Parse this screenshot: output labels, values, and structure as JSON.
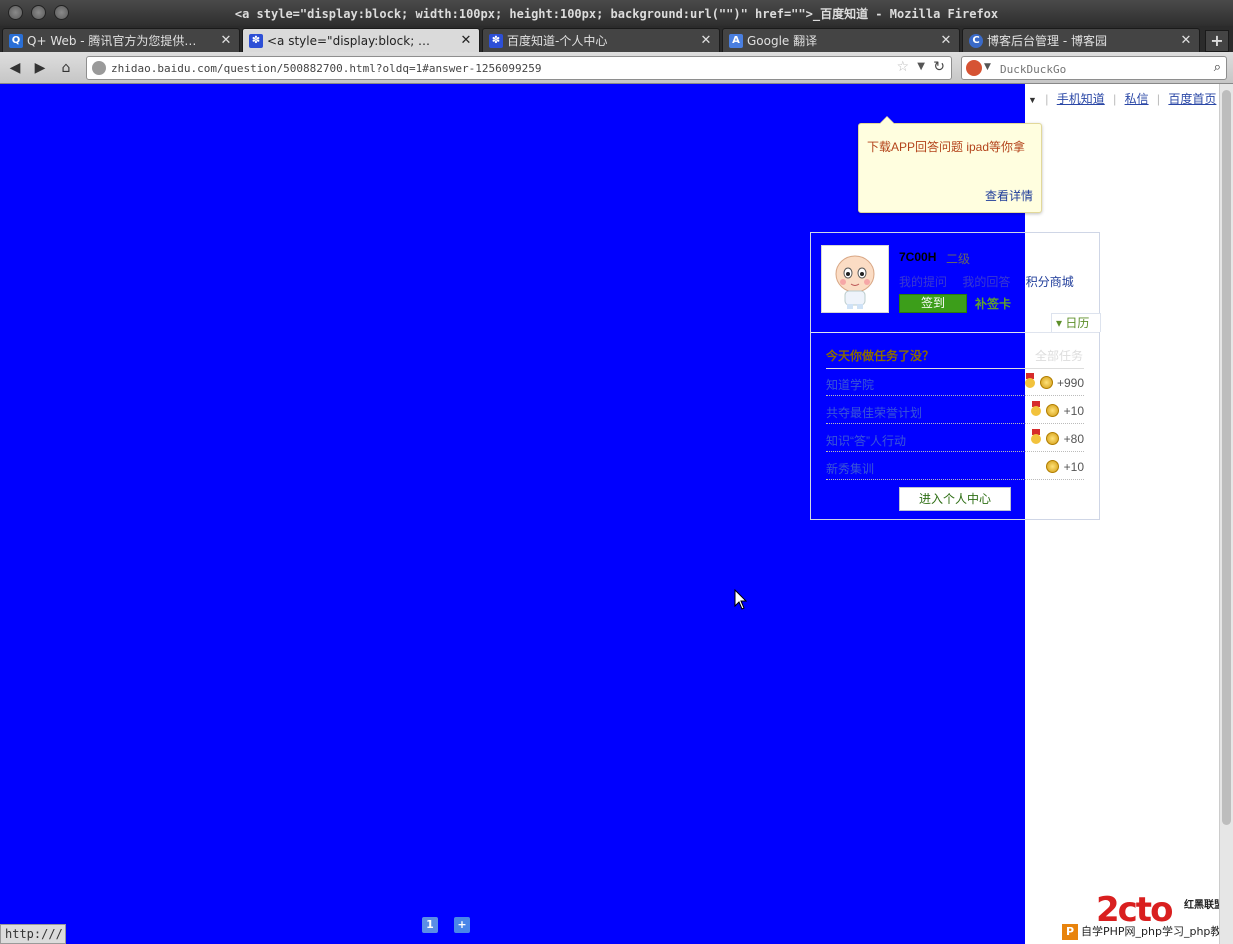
{
  "window": {
    "title": "<a style=\"display:block; width:100px; height:100px; background:url(\"\")\" href=\"\">_百度知道 - Mozilla Firefox"
  },
  "tabs": [
    {
      "label": "Q+ Web - 腾讯官方为您提供…",
      "favicon": "qplus-icon",
      "active": false
    },
    {
      "label": "<a style=\"display:block; …",
      "favicon": "baidu-paw-icon",
      "active": true
    },
    {
      "label": "百度知道-个人中心",
      "favicon": "baidu-paw-icon",
      "active": false
    },
    {
      "label": "Google 翻译",
      "favicon": "google-translate-icon",
      "active": false
    },
    {
      "label": "博客后台管理 - 博客园",
      "favicon": "cnblogs-icon",
      "active": false
    }
  ],
  "newtab_label": "+",
  "address": {
    "url": "zhidao.baidu.com/question/500882700.html?oldq=1#answer-1256099259"
  },
  "search": {
    "placeholder": "DuckDuckGo"
  },
  "toplinks": {
    "mobile": "手机知道",
    "messages": "私信",
    "home": "百度首页"
  },
  "tooltip": {
    "message": "下载APP回答问题 ipad等你拿",
    "details": "查看详情"
  },
  "user": {
    "name": "7C00H",
    "level": "二级",
    "links": [
      "我的提问",
      "我的回答",
      "积分商城"
    ],
    "sign_in": "签到",
    "makeup_card": "补签卡",
    "calendar": "日历"
  },
  "tasks": {
    "heading": "今天你做任务了没？",
    "all": "全部任务",
    "items": [
      {
        "name": "知道学院",
        "points": "+990",
        "medal": true
      },
      {
        "name": "共夺最佳荣誉计划",
        "points": "+10",
        "medal": true
      },
      {
        "name": "知识“答”人行动",
        "points": "+80",
        "medal": true
      },
      {
        "name": "新秀集训",
        "points": "+10",
        "medal": false
      }
    ],
    "enter": "进入个人中心"
  },
  "bottom_buttons": [
    "1",
    "+"
  ],
  "watermark": {
    "logo": "2cto",
    "caption": "红黑联盟",
    "bar": "自学PHP网_php学习_php教程"
  },
  "status": {
    "text": "http:///"
  },
  "colors": {
    "page_blue": "#0000ff",
    "link_blue": "#2a47a6",
    "sign_green": "#3c9e1a"
  }
}
